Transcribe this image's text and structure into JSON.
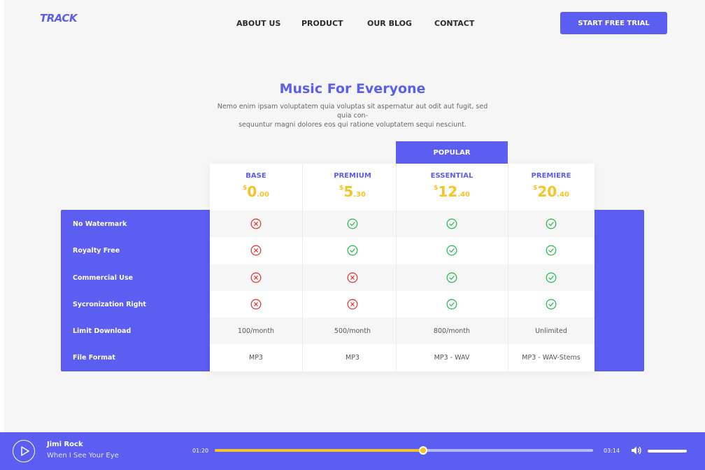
{
  "header": {
    "logo": "TRACK",
    "nav": [
      "ABOUT US",
      "PRODUCT",
      "OUR BLOG",
      "CONTACT"
    ],
    "cta_label": "START FREE TRIAL"
  },
  "hero": {
    "title": "Music For Everyone",
    "subtitle_line1": "Nemo enim ipsam voluptatem quia voluptas sit aspernatur aut odit aut fugit, sed quia con-",
    "subtitle_line2": "sequuntur magni dolores eos qui ratione voluptatem sequi nesciunt."
  },
  "pricing": {
    "popular_label": "POPULAR",
    "plans": [
      {
        "name": "BASE",
        "currency": "$",
        "price_int": "0",
        "price_dec": ".00"
      },
      {
        "name": "PREMIUM",
        "currency": "$",
        "price_int": "5",
        "price_dec": ".30"
      },
      {
        "name": "ESSENTIAL",
        "currency": "$",
        "price_int": "12",
        "price_dec": ".40"
      },
      {
        "name": "PREMIERE",
        "currency": "$",
        "price_int": "20",
        "price_dec": ".40"
      }
    ],
    "features": [
      {
        "label": "No Watermark",
        "values": [
          "no",
          "yes",
          "yes",
          "yes"
        ]
      },
      {
        "label": "Royalty Free",
        "values": [
          "no",
          "yes",
          "yes",
          "yes"
        ]
      },
      {
        "label": "Commercial Use",
        "values": [
          "no",
          "no",
          "yes",
          "yes"
        ]
      },
      {
        "label": "Sycronization Right",
        "values": [
          "no",
          "no",
          "yes",
          "yes"
        ]
      },
      {
        "label": "Limit Download",
        "values": [
          "100/month",
          "500/month",
          "800/month",
          "Unlimited"
        ]
      },
      {
        "label": "File Format",
        "values": [
          "MP3",
          "MP3",
          "MP3 - WAV",
          "MP3 - WAV-Stems"
        ]
      }
    ]
  },
  "player": {
    "artist": "Jimi Rock",
    "track": "When I See Your Eye",
    "elapsed": "01:20",
    "duration": "03:14",
    "progress_fraction": 0.55,
    "icons": [
      "play-icon",
      "volume-icon"
    ]
  },
  "colors": {
    "accent": "#5b5ef0",
    "price": "#f7c325",
    "check": "#2ebd59",
    "cross": "#e23d3d"
  }
}
